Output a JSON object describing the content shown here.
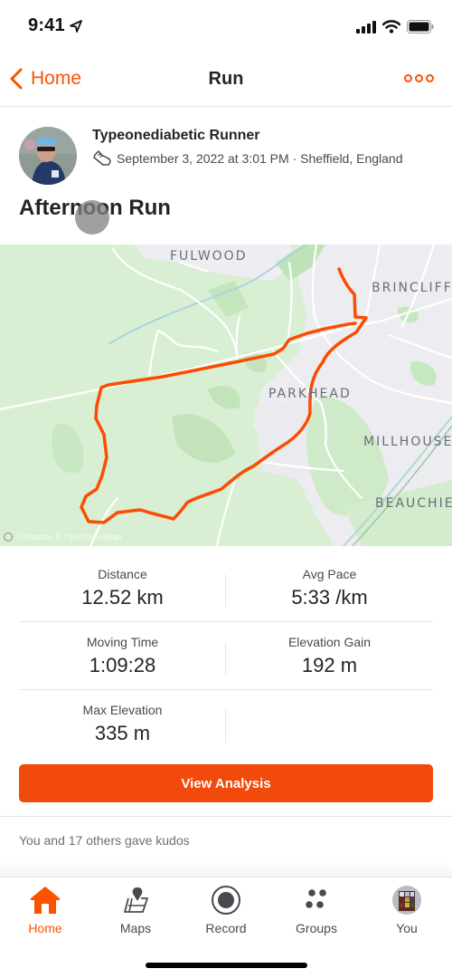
{
  "status_bar": {
    "time": "9:41",
    "icons": [
      "location-arrow-icon",
      "cellular-signal-icon",
      "wifi-icon",
      "battery-icon"
    ]
  },
  "nav": {
    "back_label": "Home",
    "title": "Run",
    "more_icon": "more-options-icon"
  },
  "activity": {
    "athlete_name": "Typeonediabetic Runner",
    "sport_icon": "running-shoe-icon",
    "date_location": "September 3, 2022 at 3:01 PM · Sheffield, England",
    "title": "Afternoon Run"
  },
  "map": {
    "labels": [
      "FULWOOD",
      "BRINCLIFFE",
      "PARKHEAD",
      "MILLHOUSES",
      "BEAUCHIEF"
    ],
    "attribution": "© Mapbox © OpenStreetMap",
    "route_color": "#fc4c02"
  },
  "stats": [
    {
      "label": "Distance",
      "value": "12.52 km"
    },
    {
      "label": "Avg Pace",
      "value": "5:33 /km"
    },
    {
      "label": "Moving Time",
      "value": "1:09:28"
    },
    {
      "label": "Elevation Gain",
      "value": "192 m"
    },
    {
      "label": "Max Elevation",
      "value": "335 m"
    }
  ],
  "actions": {
    "view_analysis": "View Analysis"
  },
  "kudos": {
    "text": "You and 17 others gave kudos"
  },
  "tab_bar": {
    "items": [
      {
        "label": "Home",
        "icon": "home-icon",
        "active": true
      },
      {
        "label": "Maps",
        "icon": "maps-icon",
        "active": false
      },
      {
        "label": "Record",
        "icon": "record-icon",
        "active": false
      },
      {
        "label": "Groups",
        "icon": "groups-icon",
        "active": false
      },
      {
        "label": "You",
        "icon": "profile-avatar",
        "active": false
      }
    ]
  },
  "colors": {
    "brand": "#fc5200",
    "button": "#f2490c"
  }
}
